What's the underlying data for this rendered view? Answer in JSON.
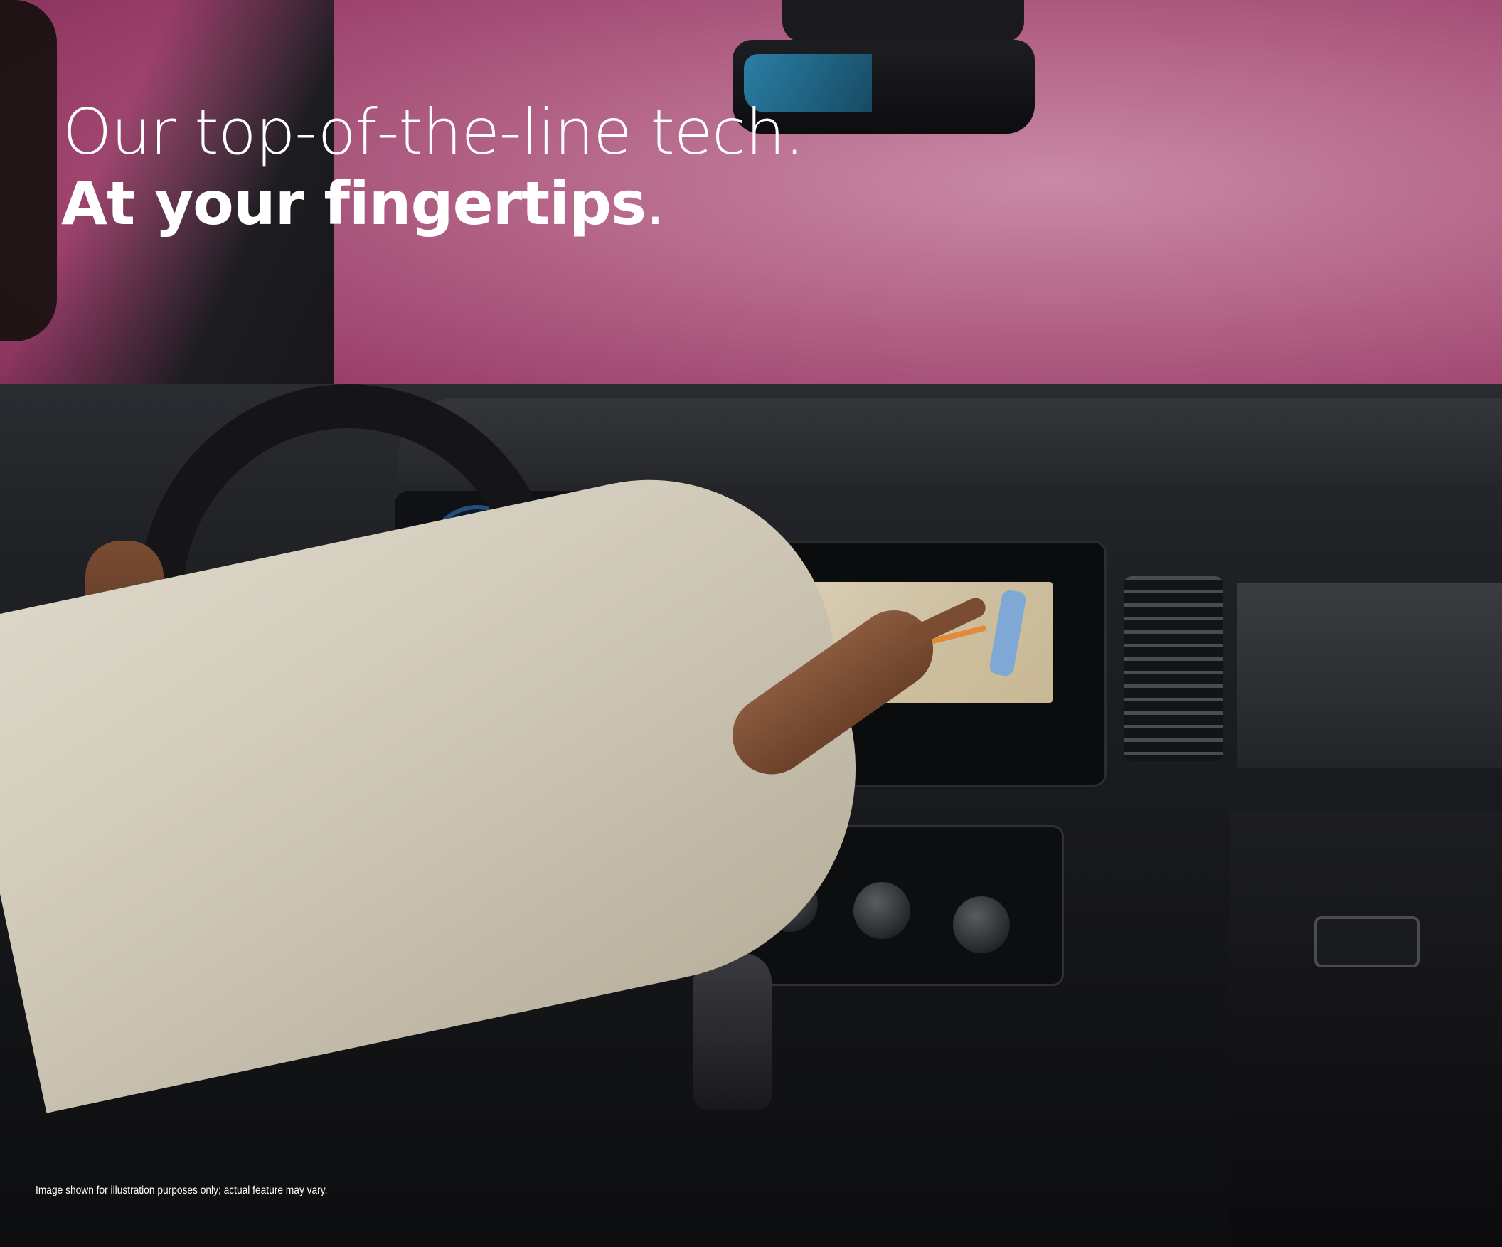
{
  "headline": {
    "line1": "Our top-of-the-line tech.",
    "line2_bold": "At your fingertips",
    "line2_punct": "."
  },
  "disclaimer": "Image shown for illustration purposes only; actual feature may vary.",
  "photo": {
    "description_icon": "car-interior-photo",
    "colors": {
      "backdrop": "#b46588",
      "headline_text": "#ffffff"
    }
  }
}
